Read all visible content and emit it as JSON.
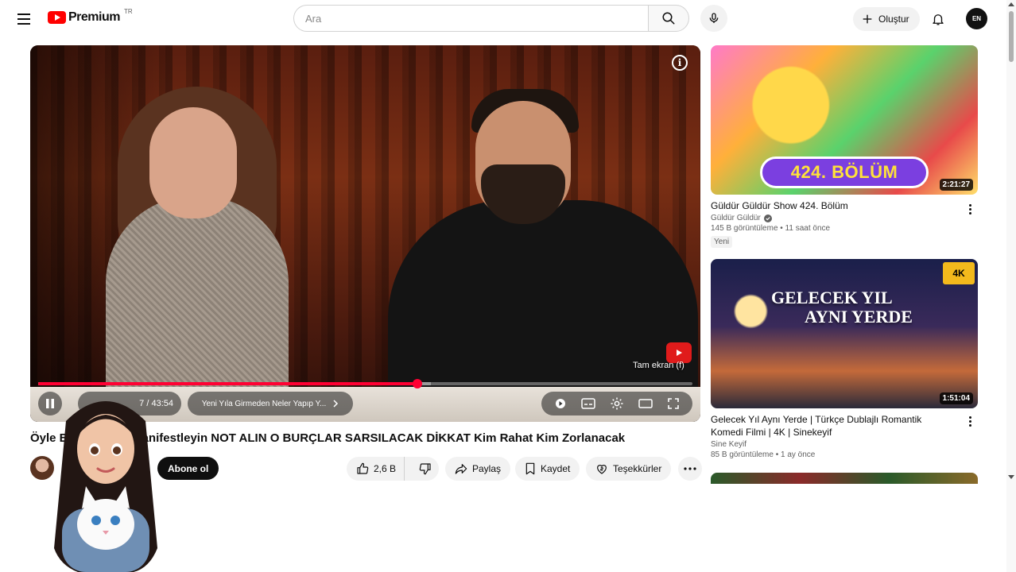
{
  "masthead": {
    "logo_text": "Premium",
    "country_code": "TR",
    "search_placeholder": "Ara",
    "create_label": "Oluştur",
    "avatar_text": "EN"
  },
  "player": {
    "time_display": "7 / 43:54",
    "chapter_label": "Yeni Yıla Girmeden Neler Yapıp Y...",
    "fullscreen_tooltip": "Tam ekran (f)",
    "progress_played": 0.58,
    "progress_buffered": 0.6
  },
  "video": {
    "title": "Öyle Bu Yılı Değil Manifestleyin NOT ALIN O BURÇLAR SARSILACAK DİKKAT Kim Rahat Kim Zorlanacak",
    "subscribe_label": "Abone ol",
    "like_count": "2,6 B",
    "share_label": "Paylaş",
    "save_label": "Kaydet",
    "thanks_label": "Teşekkürler"
  },
  "recommendations": [
    {
      "title": "Güldür Güldür Show 424. Bölüm",
      "channel": "Güldür Güldür",
      "verified": true,
      "meta": "145 B görüntüleme • 11 saat önce",
      "badge": "Yeni",
      "duration": "2:21:27",
      "thumb_text": "424. BÖLÜM"
    },
    {
      "title": "Gelecek Yıl Aynı Yerde | Türkçe Dublajlı Romantik Komedi Filmi | 4K | Sinekeyif",
      "channel": "Sine Keyif",
      "verified": false,
      "meta": "85 B görüntüleme • 1 ay önce",
      "duration": "1:51:04",
      "thumb_line1": "GELECEK YIL",
      "thumb_line2": "AYNI YERDE",
      "quality_badge": "4K"
    }
  ],
  "colors": {
    "brand_red": "#ff0000",
    "progress_red": "#ff0033",
    "text_primary": "#0f0f0f",
    "text_secondary": "#606060"
  },
  "icons": {
    "menu": "hamburger-icon",
    "search": "search-icon",
    "mic": "mic-icon",
    "create": "plus-icon",
    "notifications": "bell-icon",
    "info": "info-icon",
    "like": "thumbs-up-icon",
    "dislike": "thumbs-down-icon",
    "share": "share-arrow-icon",
    "save": "bookmark-icon",
    "thanks": "heart-dollar-icon",
    "more": "more-horizontal-icon"
  }
}
